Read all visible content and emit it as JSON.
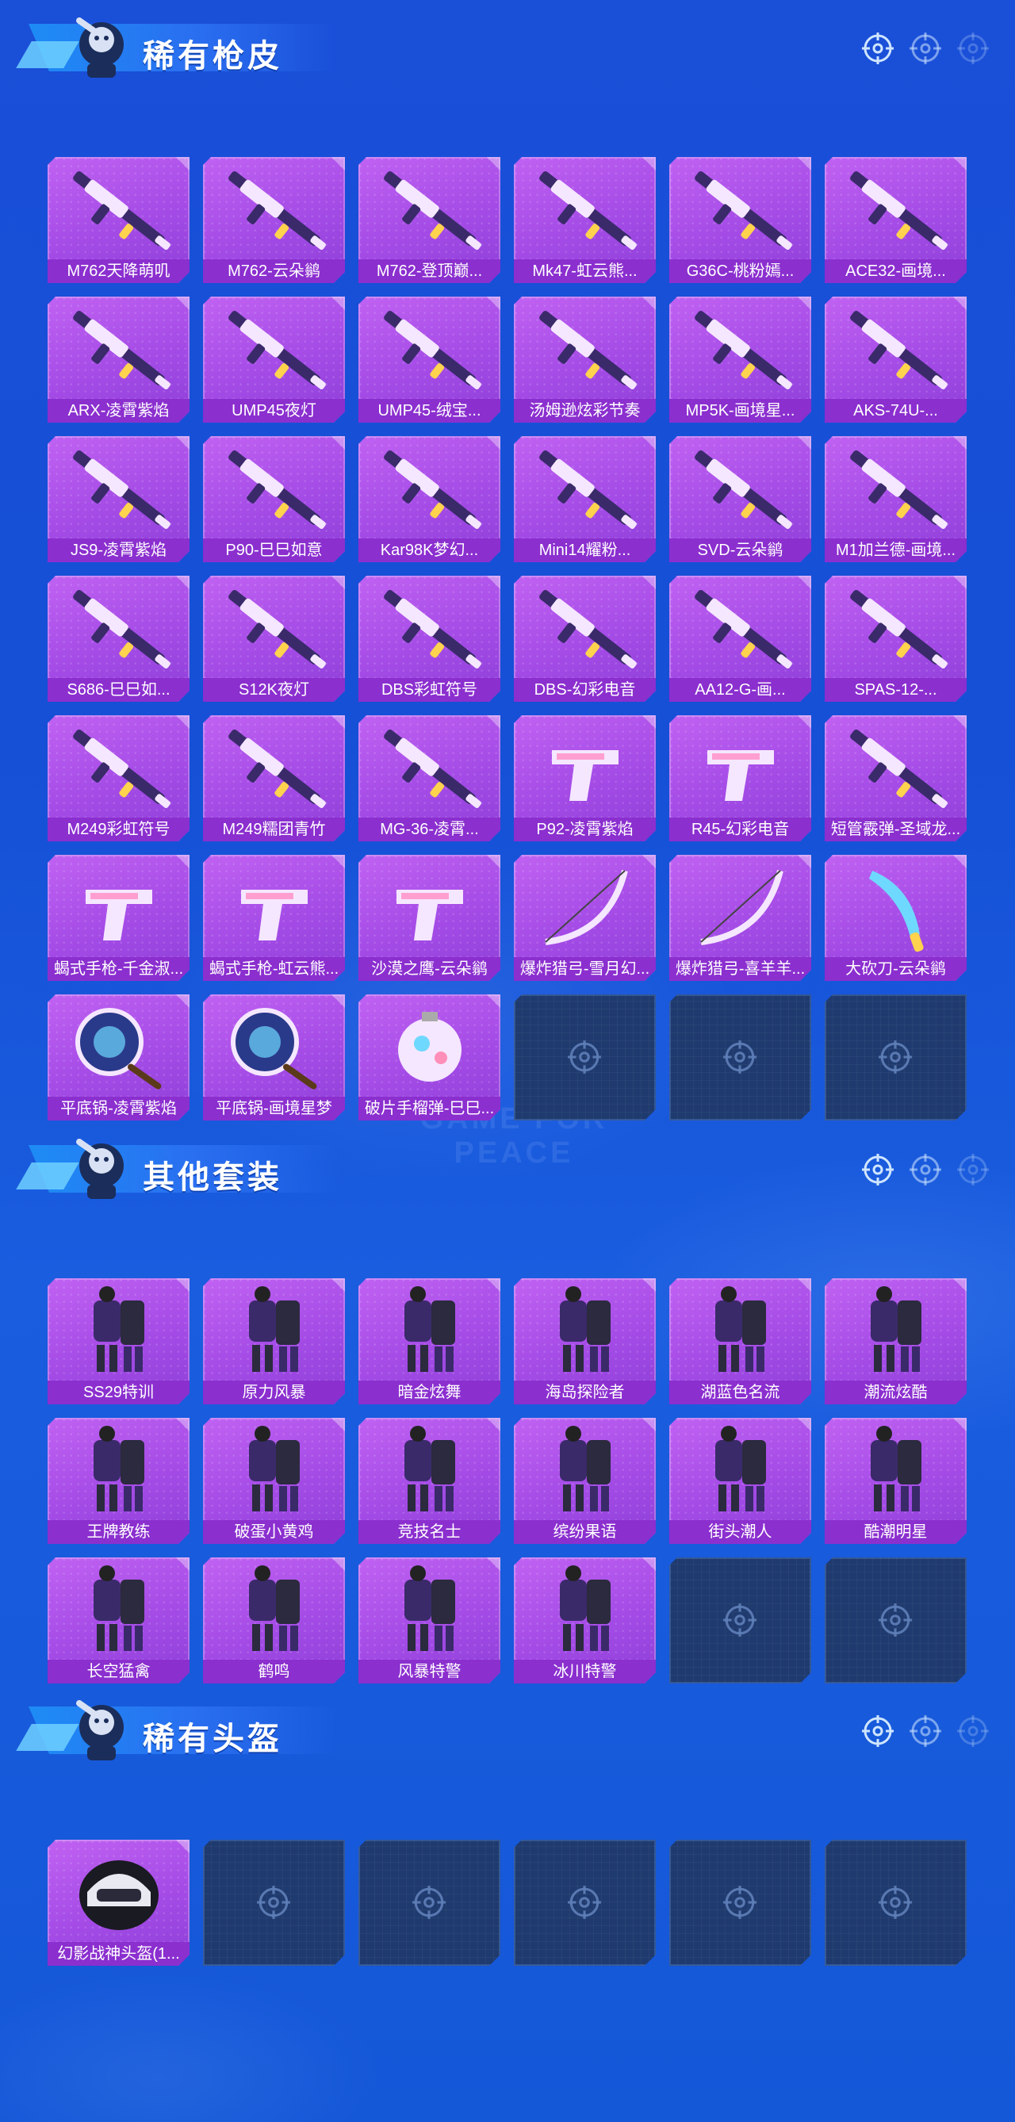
{
  "sections": [
    {
      "title": "稀有枪皮",
      "items": [
        {
          "label": "M762天降萌叽",
          "icon": "rifle-skin-icon"
        },
        {
          "label": "M762-云朵鹟",
          "icon": "rifle-skin-icon"
        },
        {
          "label": "M762-登顶巅...",
          "icon": "rifle-skin-icon"
        },
        {
          "label": "Mk47-虹云熊...",
          "icon": "rifle-skin-icon"
        },
        {
          "label": "G36C-桃粉嫣...",
          "icon": "rifle-skin-icon"
        },
        {
          "label": "ACE32-画境...",
          "icon": "rifle-skin-icon"
        },
        {
          "label": "ARX-凌霄紫焰",
          "icon": "rifle-skin-icon"
        },
        {
          "label": "UMP45夜灯",
          "icon": "smg-skin-icon"
        },
        {
          "label": "UMP45-绒宝...",
          "icon": "smg-skin-icon"
        },
        {
          "label": "汤姆逊炫彩节奏",
          "icon": "smg-skin-icon"
        },
        {
          "label": "MP5K-画境星...",
          "icon": "smg-skin-icon"
        },
        {
          "label": "AKS-74U-...",
          "icon": "rifle-skin-icon"
        },
        {
          "label": "JS9-凌霄紫焰",
          "icon": "smg-skin-icon"
        },
        {
          "label": "P90-巳巳如意",
          "icon": "smg-skin-icon"
        },
        {
          "label": "Kar98K梦幻...",
          "icon": "sniper-skin-icon"
        },
        {
          "label": "Mini14耀粉...",
          "icon": "rifle-skin-icon"
        },
        {
          "label": "SVD-云朵鹟",
          "icon": "sniper-skin-icon"
        },
        {
          "label": "M1加兰德-画境...",
          "icon": "rifle-skin-icon"
        },
        {
          "label": "S686-巳巳如...",
          "icon": "shotgun-skin-icon"
        },
        {
          "label": "S12K夜灯",
          "icon": "shotgun-skin-icon"
        },
        {
          "label": "DBS彩虹符号",
          "icon": "shotgun-skin-icon"
        },
        {
          "label": "DBS-幻彩电音",
          "icon": "shotgun-skin-icon"
        },
        {
          "label": "AA12-G-画...",
          "icon": "shotgun-skin-icon"
        },
        {
          "label": "SPAS-12-...",
          "icon": "shotgun-skin-icon"
        },
        {
          "label": "M249彩虹符号",
          "icon": "lmg-skin-icon"
        },
        {
          "label": "M249糯团青竹",
          "icon": "lmg-skin-icon"
        },
        {
          "label": "MG-36-凌霄...",
          "icon": "lmg-skin-icon"
        },
        {
          "label": "P92-凌霄紫焰",
          "icon": "pistol-skin-icon"
        },
        {
          "label": "R45-幻彩电音",
          "icon": "pistol-skin-icon"
        },
        {
          "label": "短管霰弹-圣域龙...",
          "icon": "shotgun-skin-icon"
        },
        {
          "label": "蝎式手枪-千金淑...",
          "icon": "pistol-skin-icon"
        },
        {
          "label": "蝎式手枪-虹云熊...",
          "icon": "pistol-skin-icon"
        },
        {
          "label": "沙漠之鹰-云朵鹟",
          "icon": "pistol-skin-icon"
        },
        {
          "label": "爆炸猎弓-雪月幻...",
          "icon": "bow-skin-icon"
        },
        {
          "label": "爆炸猎弓-喜羊羊...",
          "icon": "bow-skin-icon"
        },
        {
          "label": "大砍刀-云朵鹟",
          "icon": "machete-skin-icon"
        },
        {
          "label": "平底锅-凌霄紫焰",
          "icon": "pan-skin-icon"
        },
        {
          "label": "平底锅-画境星梦",
          "icon": "pan-skin-icon"
        },
        {
          "label": "破片手榴弹-巳巳...",
          "icon": "grenade-skin-icon"
        }
      ],
      "empty_slots": 3
    },
    {
      "title": "其他套装",
      "items": [
        {
          "label": "SS29特训",
          "icon": "outfit-icon"
        },
        {
          "label": "原力风暴",
          "icon": "outfit-icon"
        },
        {
          "label": "暗金炫舞",
          "icon": "outfit-icon"
        },
        {
          "label": "海岛探险者",
          "icon": "outfit-icon"
        },
        {
          "label": "湖蓝色名流",
          "icon": "outfit-icon"
        },
        {
          "label": "潮流炫酷",
          "icon": "outfit-icon"
        },
        {
          "label": "王牌教练",
          "icon": "outfit-icon"
        },
        {
          "label": "破蛋小黄鸡",
          "icon": "outfit-icon"
        },
        {
          "label": "竞技名士",
          "icon": "outfit-icon"
        },
        {
          "label": "缤纷果语",
          "icon": "outfit-icon"
        },
        {
          "label": "街头潮人",
          "icon": "outfit-icon"
        },
        {
          "label": "酷潮明星",
          "icon": "outfit-icon"
        },
        {
          "label": "长空猛禽",
          "icon": "outfit-icon"
        },
        {
          "label": "鹤鸣",
          "icon": "outfit-icon"
        },
        {
          "label": "风暴特警",
          "icon": "outfit-icon"
        },
        {
          "label": "冰川特警",
          "icon": "outfit-icon"
        }
      ],
      "empty_slots": 2
    },
    {
      "title": "稀有头盔",
      "items": [
        {
          "label": "幻影战神头盔(1...",
          "icon": "helmet-icon"
        }
      ],
      "empty_slots": 5
    }
  ],
  "watermark": "GAME FOR PEACE",
  "colors": {
    "background": "#1a4fd8",
    "card": "#a44be6",
    "card_label": "#8b2fcf",
    "empty_slot": "#1f3a6e",
    "banner": "#1e8cf5"
  }
}
